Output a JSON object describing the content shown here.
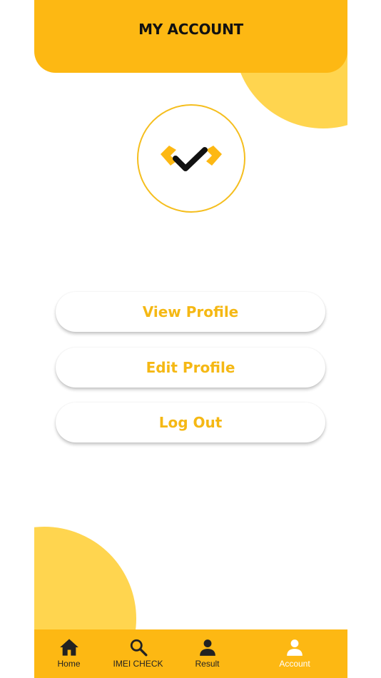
{
  "header": {
    "title": "MY ACCOUNT"
  },
  "logo": {
    "icon": "checkmark-logo-icon",
    "colors": {
      "accent": "#FDB813",
      "dark": "#111111"
    }
  },
  "menu": {
    "view_profile_label": "View Profile",
    "edit_profile_label": "Edit Profile",
    "logout_label": "Log Out"
  },
  "nav": {
    "items": [
      {
        "label": "Home",
        "icon": "home-icon"
      },
      {
        "label": "IMEI CHECK",
        "icon": "search-icon"
      },
      {
        "label": "Result",
        "icon": "person-icon"
      },
      {
        "label": "Account",
        "icon": "account-icon",
        "active": true
      }
    ]
  },
  "colors": {
    "primary": "#FDB813",
    "secondary": "#FFD54F",
    "button_text": "#F5B814",
    "nav_active": "#FFFFFF"
  }
}
